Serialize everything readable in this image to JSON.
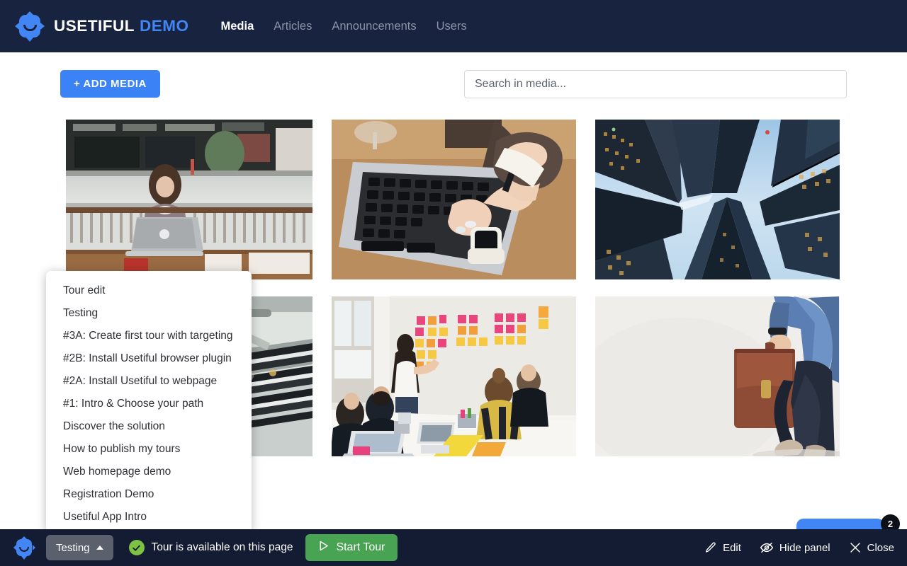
{
  "header": {
    "brand_main": "USETIFUL",
    "brand_sub": "DEMO",
    "logo_icon": "usetiful-robot-logo-icon",
    "nav": [
      {
        "label": "Media",
        "active": true
      },
      {
        "label": "Articles",
        "active": false
      },
      {
        "label": "Announcements",
        "active": false
      },
      {
        "label": "Users",
        "active": false
      }
    ]
  },
  "toolbar": {
    "add_media_label": "+ ADD MEDIA",
    "search_placeholder": "Search in media...",
    "search_value": ""
  },
  "media_grid": {
    "tiles": [
      {
        "alt": "woman-working-on-laptop-at-outdoor-cafe"
      },
      {
        "alt": "hands-typing-on-laptop-keyboard-at-wooden-desk"
      },
      {
        "alt": "skyscrapers-viewed-from-below-against-blue-sky"
      },
      {
        "alt": "escalator-and-stairs-in-modern-building"
      },
      {
        "alt": "team-workshop-with-sticky-notes-on-wall"
      },
      {
        "alt": "businessman-walking-with-leather-briefcase"
      }
    ]
  },
  "tour_dropdown": {
    "items": [
      "Tour edit",
      "Testing",
      "#3A: Create first tour with targeting",
      "#2B: Install Usetiful browser plugin",
      "#2A: Install Usetiful to webpage",
      "#1: Intro & Choose your path",
      "Discover the solution",
      "How to publish my tours",
      "Web homepage demo",
      "Registration Demo",
      "Usetiful App Intro"
    ]
  },
  "floating_widget": {
    "badge_count": "2"
  },
  "bottom_bar": {
    "logo_icon": "usetiful-robot-logo-icon",
    "selected_tour": "Testing",
    "chevron_icon": "chevron-up-icon",
    "status_icon": "check-circle-icon",
    "status_text": "Tour is available on this page",
    "start_tour_label": "Start Tour",
    "play_icon": "play-triangle-icon",
    "actions": [
      {
        "label": "Edit",
        "icon": "pencil-icon"
      },
      {
        "label": "Hide panel",
        "icon": "eye-slash-icon"
      },
      {
        "label": "Close",
        "icon": "close-x-icon"
      }
    ]
  },
  "colors": {
    "navbar_bg": "#182340",
    "bottombar_bg": "#131c33",
    "accent_blue": "#4285f4",
    "button_blue": "#3b82f6",
    "green": "#48a353",
    "check_green": "#7dc243",
    "select_gray": "#5a616d"
  }
}
